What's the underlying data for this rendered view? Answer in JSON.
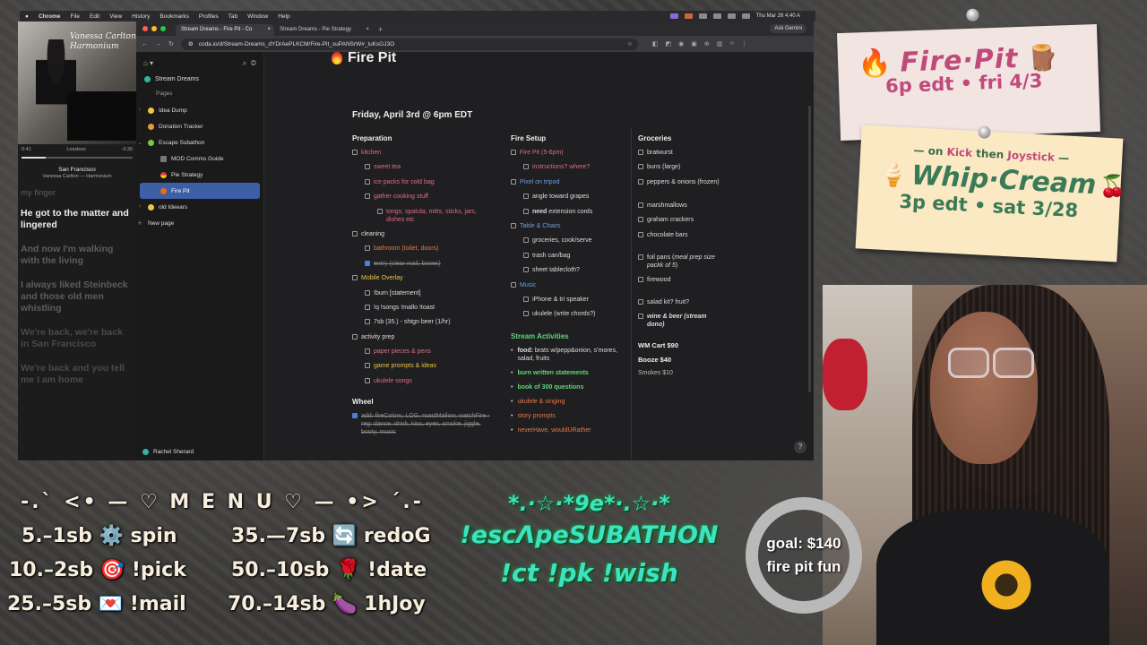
{
  "menubar": {
    "app": "Chrome",
    "items": [
      "File",
      "Edit",
      "View",
      "History",
      "Bookmarks",
      "Profiles",
      "Tab",
      "Window",
      "Help"
    ],
    "clock": "Thu Mar 26  4:40 A"
  },
  "player": {
    "album_title": "Vanessa Carlton Harmonium",
    "elapsed": "0:41",
    "quality": "Lossless",
    "remaining": "-3:30",
    "progress": 0.22,
    "song": "San Francisco",
    "artist": "Vanessa Carlton — Harmonium",
    "lyrics": [
      "my finger",
      "He got to the matter and lingered",
      "And now I'm walking with the living",
      "I always liked Steinbeck and those old men whistling",
      "We're back, we're back in San Francisco",
      "We're back and you tell me I am home"
    ]
  },
  "browser": {
    "tabs": [
      {
        "title": "Stream Dreams - Fire Pit - Co"
      },
      {
        "title": "Stream Dreams - Pie Strategy"
      }
    ],
    "ask": "Ask Gemini",
    "url": "coda.io/d/Stream-Dreams_dYDrAePLKCM/Fire-Pit_suPANSrW#_luKsGJ3O"
  },
  "sidebar": {
    "doc": "Stream Dreams",
    "pages_label": "Pages",
    "items": [
      {
        "label": "Idea Dump"
      },
      {
        "label": "Donation Tracker"
      },
      {
        "label": "Escape Subathon"
      },
      {
        "label": "MOD Comms Guide"
      },
      {
        "label": "Pie Strategy"
      },
      {
        "label": "Fire Pit"
      },
      {
        "label": "old Ideears"
      }
    ],
    "new_page": "New page",
    "user": "Rachel Sherard"
  },
  "page": {
    "title": "Fire Pit",
    "date": "Friday, April 3rd @ 6pm EDT",
    "prep": {
      "heading": "Preparation",
      "kitchen": "kitchen",
      "sweet_tea": "sweet tea",
      "ice_packs": "ice packs for cold bag",
      "gather": "gather cooking stuff",
      "tongs": "tongs, spatula, mitts, sticks, jars, dishes etc",
      "cleaning": "cleaning",
      "bathroom": "bathroom (toilet, doors)",
      "entry": "entry (clear mail, boxes)",
      "mobile": "Mobile Overlay",
      "burn": "!burn [statement]",
      "songs": "!q !songs !mallo !toast",
      "sb": "7sb (35.) - shtgn beer (1/hr)",
      "activity": "activity prep",
      "paper": "paper pieces & pens",
      "game": "game prompts & ideas",
      "ukulele": "ukulele songs"
    },
    "wheel": {
      "heading": "Wheel",
      "item": "add: fireColors, LOG, roastMallow, watchFire - reg: dance, drink, kiss, eyes, smoke, jiggle, booty, music"
    },
    "fire_setup": {
      "heading": "Fire Setup",
      "fire_pit": "Fire Pit (5-6pm)",
      "instructions": "instructions? where?",
      "pixel": "Pixel on tripod",
      "angle": "angle toward grapes",
      "need_b": "need",
      "need": " extension cords",
      "table": "Table & Chairs",
      "groceries": "groceries, cook/serve",
      "trash": "trash can/bag",
      "sheet": "sheet tablecloth?",
      "music": "Music",
      "iphone": "iPhone & tri speaker",
      "ukulele": "ukulele (write chords?)"
    },
    "activities": {
      "heading": "Stream Activities",
      "food_b": "food:",
      "food": " brats w/pepp&onion, s'mores, salad, fruits",
      "burn": "burn written statements",
      "book": "book of 300 questions",
      "ukulele": "ukulele & singing",
      "story": "story prompts",
      "never": "neverHave, wouldURather"
    },
    "groceries": {
      "heading": "Groceries",
      "items": [
        "bratwurst",
        "buns (large)",
        "peppers & onions (frozen)",
        "marshmallows",
        "graham crackers",
        "chocolate bars"
      ],
      "foil": "foil pans (",
      "foil_i": "meal prep size packk of 5",
      "foil_end": ")",
      "firewood": "firewood",
      "salad": "salad kit? fruit?",
      "wine": "wine & beer (stream dono)",
      "wm": "WM Cart $90",
      "booze": "Booze $40",
      "smokes": "Smokes $10"
    }
  },
  "overlay": {
    "n1_title": "Fire·Pit",
    "n1_sub": "6p edt • fri 4/3",
    "n2_small_a": "— on ",
    "n2_kick": "Kick",
    "n2_then": " then ",
    "n2_joy": "Joystick",
    "n2_small_b": " —",
    "n2_title": "Whip·Cream",
    "n2_sub": "3p edt • sat 3/28",
    "menu_head": "-.` <• — ♡ M E N U ♡ — •> ´.-",
    "menu": [
      {
        "t": "5.–1sb ⚙️ spin"
      },
      {
        "t": "35.—7sb 🔄 redoG"
      },
      {
        "t": "10.–2sb 🎯 !pick"
      },
      {
        "t": "50.–10sb 🌹 !date"
      },
      {
        "t": "25.–5sb 💌 !mail"
      },
      {
        "t": "70.–14sb 🍆 1hJoy"
      }
    ],
    "esc_deco": "*.·☆·*9e*·.☆·*",
    "esc": "!escΛpeSUBATHON",
    "cmds": "!ct !pk !wish",
    "goal": "goal: $140",
    "goal_sub": "fire pit fun",
    "goal_progress": 0.55
  }
}
